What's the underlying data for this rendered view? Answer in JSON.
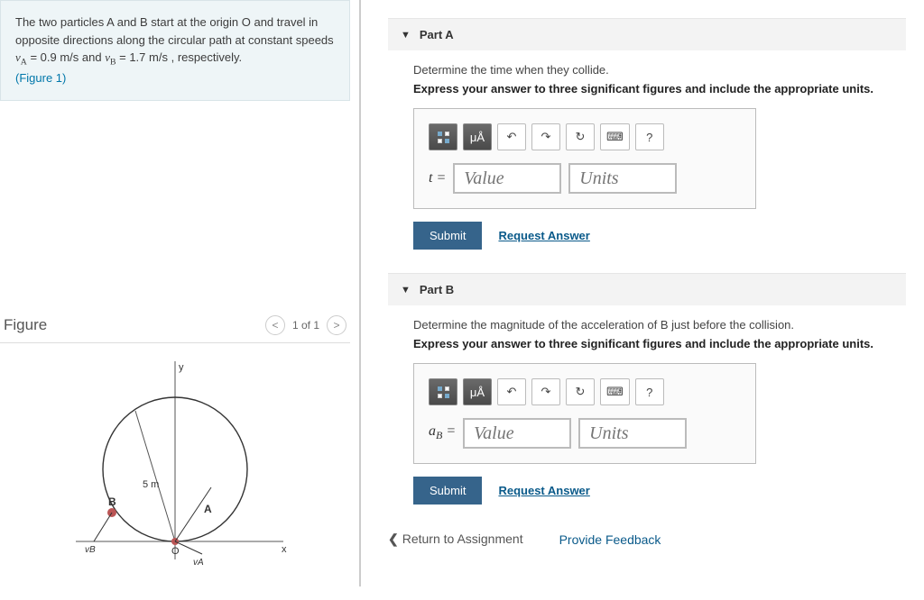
{
  "problem": {
    "text_1": "The two particles A and B start at the origin O and travel in opposite directions along the circular path at constant speeds ",
    "vA_label": "v",
    "vA_sub": "A",
    "vA_eq": " = 0.9 m/s",
    "and": " and ",
    "vB_label": "v",
    "vB_sub": "B",
    "vB_eq": " = 1.7 m/s",
    "tail": " , respectively.",
    "figure_link": "(Figure 1)"
  },
  "figure_section": {
    "title": "Figure",
    "pager_text": "1 of 1",
    "prev": "<",
    "next": ">",
    "diagram": {
      "radius_label": "5 m",
      "axis_x": "x",
      "axis_y": "y",
      "origin": "O",
      "pointA": "A",
      "pointB": "B",
      "vA": "vA",
      "vB": "vB"
    }
  },
  "toolbar": {
    "mu_a": "μÅ",
    "undo": "↶",
    "redo": "↷",
    "reset": "↻",
    "keyboard": "⌨",
    "help": "?"
  },
  "partA": {
    "name": "Part A",
    "question": "Determine the time when they collide.",
    "instruction": "Express your answer to three significant figures and include the appropriate units.",
    "var": "t =",
    "value_ph": "Value",
    "units_ph": "Units",
    "submit": "Submit",
    "request": "Request Answer"
  },
  "partB": {
    "name": "Part B",
    "question": "Determine the magnitude of the acceleration of B just before the collision.",
    "instruction": "Express your answer to three significant figures and include the appropriate units.",
    "var_html": "aB =",
    "var_pre": "a",
    "var_sub": "B",
    "var_post": " =",
    "value_ph": "Value",
    "units_ph": "Units",
    "submit": "Submit",
    "request": "Request Answer"
  },
  "footer": {
    "return": "Return to Assignment",
    "feedback": "Provide Feedback"
  }
}
